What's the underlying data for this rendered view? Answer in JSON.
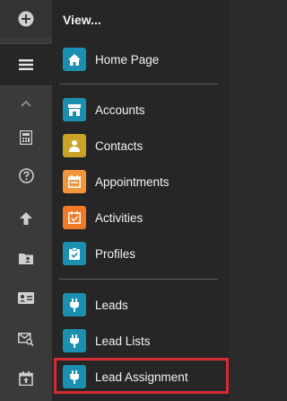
{
  "panel": {
    "title": "View..."
  },
  "rail": {
    "icons": [
      "plus-circle-icon",
      "menu-icon",
      "chevron-up-icon",
      "calculator-icon",
      "help-icon",
      "upload-arrow-icon",
      "contact-folder-icon",
      "id-card-icon",
      "mail-search-icon",
      "calendar-export-icon"
    ]
  },
  "items": {
    "home": {
      "label": "Home Page",
      "icon": "home-icon",
      "color": "#1b8fb0"
    },
    "accounts": {
      "label": "Accounts",
      "icon": "store-icon",
      "color": "#1b8fb0"
    },
    "contacts": {
      "label": "Contacts",
      "icon": "person-icon",
      "color": "#c9a227"
    },
    "appointments": {
      "label": "Appointments",
      "icon": "calendar-icon",
      "color": "#f1963a"
    },
    "activities": {
      "label": "Activities",
      "icon": "calendar-check-icon",
      "color": "#f07a28"
    },
    "profiles": {
      "label": "Profiles",
      "icon": "clipboard-check-icon",
      "color": "#1b8fb0"
    },
    "leads": {
      "label": "Leads",
      "icon": "plug-icon",
      "color": "#1b8fb0"
    },
    "lead_lists": {
      "label": "Lead Lists",
      "icon": "plug-icon",
      "color": "#1b8fb0"
    },
    "lead_assignment": {
      "label": "Lead Assignment",
      "icon": "plug-icon",
      "color": "#1b8fb0"
    }
  },
  "colors": {
    "highlight": "#d52b35",
    "rail_bg": "#3a3a3a",
    "panel_bg": "#262626"
  }
}
